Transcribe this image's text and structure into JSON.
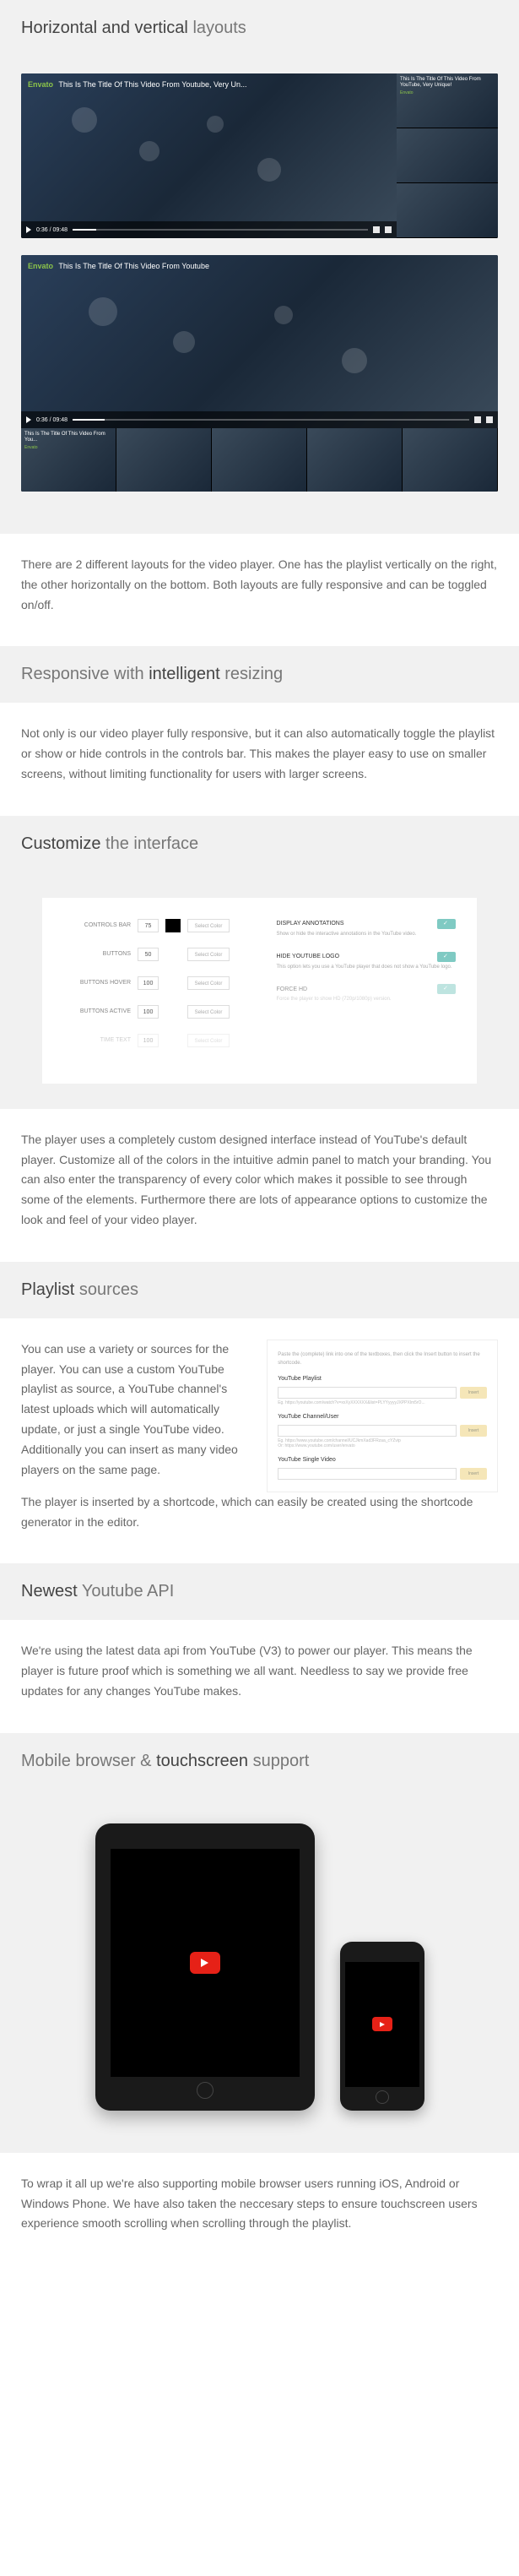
{
  "sections": {
    "layouts": {
      "heading_strong": "Horizontal and vertical",
      "heading_light": "layouts",
      "body": "There are 2 different layouts for the video player. One has the playlist vertically on the right, the other horizontally on the bottom. Both layouts are fully responsive and can be toggled on/off."
    },
    "responsive": {
      "heading_light_pre": "Responsive with",
      "heading_strong": "intelligent",
      "heading_light_post": "resizing",
      "body": "Not only is our video player fully responsive, but it can also automatically toggle the playlist or show or hide controls in the controls bar. This makes the player easy to use on smaller screens, without limiting functionality for users with larger screens."
    },
    "customize": {
      "heading_strong": "Customize",
      "heading_light": "the interface",
      "body": "The player uses a completely custom designed interface instead of YouTube's default player. Customize all of the colors in the intuitive admin panel to match your branding. You can also enter the transparency of every color which makes it possible to see through some of the elements. Furthermore there are lots of appearance options to customize the look and feel of your video player."
    },
    "sources": {
      "heading_strong": "Playlist",
      "heading_light": "sources",
      "body_left": "You can use a variety or sources for the player. You can use a custom YouTube playlist as source, a YouTube channel's latest uploads which will automatically update, or just a single YouTube video. Additionally you can insert as many video players on the same page.",
      "body_full": "The player is inserted by a shortcode, which can easily be created using the shortcode generator in the editor."
    },
    "api": {
      "heading_strong": "Newest",
      "heading_light": "Youtube API",
      "body": "We're using the latest data api from YouTube (V3) to power our player. This means the player is future proof which is something we all want. Needless to say we provide free updates for any changes YouTube makes."
    },
    "mobile": {
      "heading_light_pre": "Mobile",
      "heading_light_mid": "browser &",
      "heading_strong": "touchscreen",
      "heading_light_post": "support",
      "body": "To wrap it all up we're also supporting mobile browser users running iOS, Android or Windows Phone. We have also taken the neccesary steps to ensure touchscreen users experience smooth scrolling when scrolling through the playlist."
    }
  },
  "player": {
    "brand": "Envato",
    "title_h": "This Is The Title Of This Video From Youtube, Very Un...",
    "title_v": "This Is The Title Of This Video From Youtube",
    "time": "0:36 / 09:48",
    "side_item_title": "This Is The Title Of This Video From YouTube, Very Unique!",
    "side_item_sub": "Envato",
    "bottom_item_title": "This Is The Title Of This Video From You...",
    "bottom_item_sub": "Envato"
  },
  "customize_panel": {
    "rows": [
      {
        "label": "CONTROLS BAR",
        "num": "75",
        "swatch": "#000000",
        "btn": "Select Color"
      },
      {
        "label": "BUTTONS",
        "num": "50",
        "swatch": "",
        "btn": "Select Color"
      },
      {
        "label": "BUTTONS HOVER",
        "num": "100",
        "swatch": "",
        "btn": "Select Color"
      },
      {
        "label": "BUTTONS ACTIVE",
        "num": "100",
        "swatch": "",
        "btn": "Select Color"
      },
      {
        "label": "TIME TEXT",
        "num": "100",
        "swatch": "",
        "btn": "Select Color"
      }
    ],
    "opts": [
      {
        "title": "DISPLAY ANNOTATIONS",
        "desc": "Show or hide the interactive annotations in the YouTube video."
      },
      {
        "title": "HIDE YOUTUBE LOGO",
        "desc": "This option lets you use a YouTube player that does not show a YouTube logo."
      },
      {
        "title": "FORCE HD",
        "desc": "Force the player to show HD (720p/1080p) version."
      }
    ]
  },
  "src_panel": {
    "instruction": "Paste the (complete) link into one of the textboxes, then click the Insert button to insert the shortcode.",
    "fields": [
      {
        "label": "YouTube Playlist",
        "btn": "Insert",
        "eg": "Eg. https://youtube.com/watch?v=xxXyXXXXXX&list=PLYYyyyyJXPPXlm5rO..."
      },
      {
        "label": "YouTube Channel/User",
        "btn": "Insert",
        "eg": "Eg. https://www.youtube.com/channel/UCJkmXad3FRzaa_cYZvip\nOr: https://www.youtube.com/user/envato"
      },
      {
        "label": "YouTube Single Video",
        "btn": "Insert",
        "eg": ""
      }
    ]
  }
}
